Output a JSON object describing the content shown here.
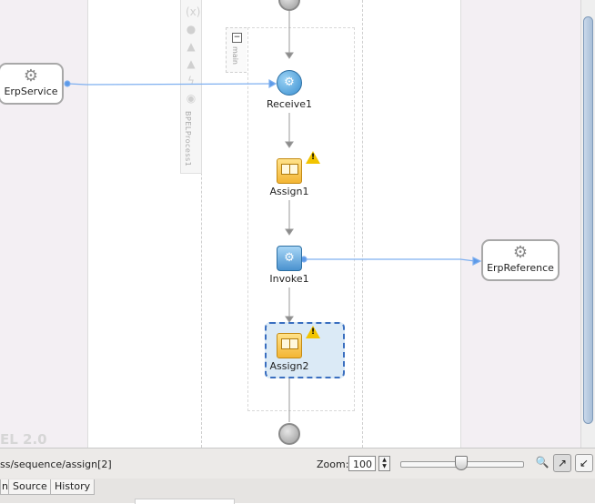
{
  "process": {
    "name": "BPELProcess1",
    "scope_label": "main",
    "bpel_version": "EL 2.0"
  },
  "partner_links": {
    "left": {
      "label": "ErpService",
      "icon": "gear-icon"
    },
    "right": {
      "label": "ErpReference",
      "icon": "gear-icon"
    }
  },
  "activities": [
    {
      "label": "Receive1",
      "type": "receive",
      "icon": "gear-icon"
    },
    {
      "label": "Assign1",
      "type": "assign",
      "warning": true
    },
    {
      "label": "Invoke1",
      "type": "invoke",
      "icon": "gear-icon"
    },
    {
      "label": "Assign2",
      "type": "assign",
      "warning": true,
      "selected": true
    }
  ],
  "toolbar_icons": [
    "variable-icon",
    "partner-icon",
    "triangle-icon",
    "triangle-icon",
    "flash-icon",
    "mail-icon"
  ],
  "status": {
    "path": "ss/sequence/assign[2]",
    "zoom_label": "Zoom:",
    "zoom_value": "100",
    "zoom_slider_fraction": 0.5
  },
  "tabs": [
    {
      "label": "n"
    },
    {
      "label": "Source"
    },
    {
      "label": "History"
    }
  ],
  "colors": {
    "lane": "#f3eff3",
    "link": "#7fb0f0",
    "selection": "#3a6fc0",
    "assign": "#f3b534",
    "receive": "#3a8fd0"
  }
}
